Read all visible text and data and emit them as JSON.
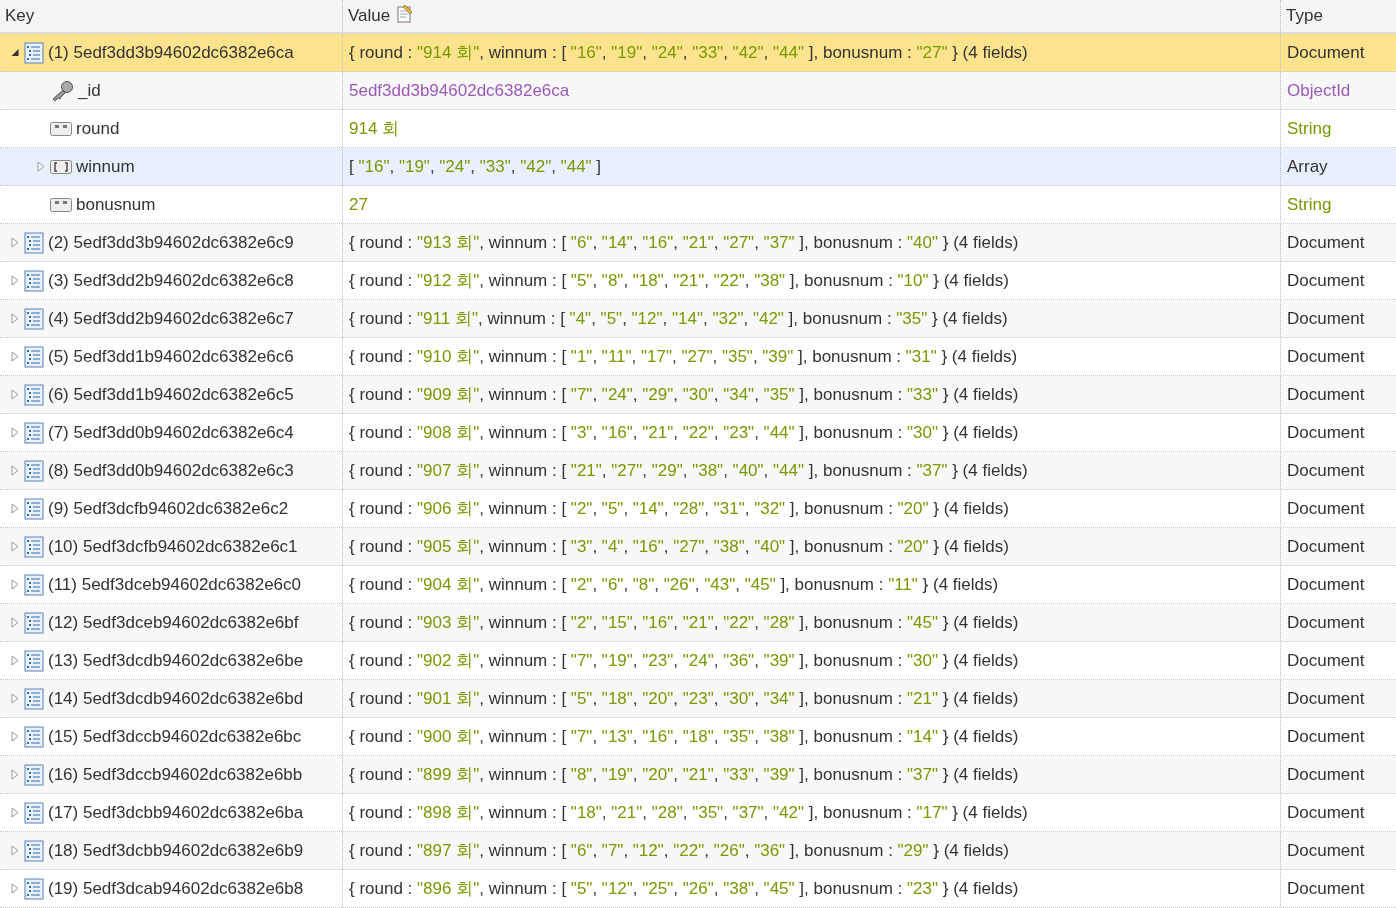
{
  "columns": [
    {
      "label": "Key",
      "edit_icon": false
    },
    {
      "label": "Value",
      "edit_icon": true
    },
    {
      "label": "Type",
      "edit_icon": false
    }
  ],
  "documents": [
    {
      "key": "(1) 5edf3dd3b94602dc6382e6ca",
      "expanded": true,
      "selected": true,
      "type": "Document",
      "value": [
        "{ round : ",
        "\"914 회\"",
        ", winnum : [ ",
        "\"16\"",
        ", ",
        "\"19\"",
        ", ",
        "\"24\"",
        ", ",
        "\"33\"",
        ", ",
        "\"42\"",
        ", ",
        "\"44\"",
        " ], bonusnum : ",
        "\"27\"",
        " } (4 fields)"
      ],
      "children": [
        {
          "kind": "objectid",
          "key": "_id",
          "value": [
            "5edf3dd3b94602dc6382e6ca"
          ],
          "type": "ObjectId",
          "hovered": false
        },
        {
          "kind": "string",
          "key": "round",
          "value": [
            "914 회"
          ],
          "type": "String",
          "hovered": false
        },
        {
          "kind": "array",
          "key": "winnum",
          "value": [
            "[ ",
            "\"16\"",
            ", ",
            "\"19\"",
            ", ",
            "\"24\"",
            ", ",
            "\"33\"",
            ", ",
            "\"42\"",
            ", ",
            "\"44\"",
            " ]"
          ],
          "type": "Array",
          "hovered": true
        },
        {
          "kind": "string",
          "key": "bonusnum",
          "value": [
            "27"
          ],
          "type": "String",
          "hovered": false
        }
      ]
    },
    {
      "key": "(2) 5edf3dd3b94602dc6382e6c9",
      "expanded": false,
      "selected": false,
      "type": "Document",
      "value": [
        "{ round : ",
        "\"913 회\"",
        ", winnum : [ ",
        "\"6\"",
        ", ",
        "\"14\"",
        ", ",
        "\"16\"",
        ", ",
        "\"21\"",
        ", ",
        "\"27\"",
        ", ",
        "\"37\"",
        " ], bonusnum : ",
        "\"40\"",
        " } (4 fields)"
      ]
    },
    {
      "key": "(3) 5edf3dd2b94602dc6382e6c8",
      "expanded": false,
      "selected": false,
      "type": "Document",
      "value": [
        "{ round : ",
        "\"912 회\"",
        ", winnum : [ ",
        "\"5\"",
        ", ",
        "\"8\"",
        ", ",
        "\"18\"",
        ", ",
        "\"21\"",
        ", ",
        "\"22\"",
        ", ",
        "\"38\"",
        " ], bonusnum : ",
        "\"10\"",
        " } (4 fields)"
      ]
    },
    {
      "key": "(4) 5edf3dd2b94602dc6382e6c7",
      "expanded": false,
      "selected": false,
      "type": "Document",
      "value": [
        "{ round : ",
        "\"911 회\"",
        ", winnum : [ ",
        "\"4\"",
        ", ",
        "\"5\"",
        ", ",
        "\"12\"",
        ", ",
        "\"14\"",
        ", ",
        "\"32\"",
        ", ",
        "\"42\"",
        " ], bonusnum : ",
        "\"35\"",
        " } (4 fields)"
      ]
    },
    {
      "key": "(5) 5edf3dd1b94602dc6382e6c6",
      "expanded": false,
      "selected": false,
      "type": "Document",
      "value": [
        "{ round : ",
        "\"910 회\"",
        ", winnum : [ ",
        "\"1\"",
        ", ",
        "\"11\"",
        ", ",
        "\"17\"",
        ", ",
        "\"27\"",
        ", ",
        "\"35\"",
        ", ",
        "\"39\"",
        " ], bonusnum : ",
        "\"31\"",
        " } (4 fields)"
      ]
    },
    {
      "key": "(6) 5edf3dd1b94602dc6382e6c5",
      "expanded": false,
      "selected": false,
      "type": "Document",
      "value": [
        "{ round : ",
        "\"909 회\"",
        ", winnum : [ ",
        "\"7\"",
        ", ",
        "\"24\"",
        ", ",
        "\"29\"",
        ", ",
        "\"30\"",
        ", ",
        "\"34\"",
        ", ",
        "\"35\"",
        " ], bonusnum : ",
        "\"33\"",
        " } (4 fields)"
      ]
    },
    {
      "key": "(7) 5edf3dd0b94602dc6382e6c4",
      "expanded": false,
      "selected": false,
      "type": "Document",
      "value": [
        "{ round : ",
        "\"908 회\"",
        ", winnum : [ ",
        "\"3\"",
        ", ",
        "\"16\"",
        ", ",
        "\"21\"",
        ", ",
        "\"22\"",
        ", ",
        "\"23\"",
        ", ",
        "\"44\"",
        " ], bonusnum : ",
        "\"30\"",
        " } (4 fields)"
      ]
    },
    {
      "key": "(8) 5edf3dd0b94602dc6382e6c3",
      "expanded": false,
      "selected": false,
      "type": "Document",
      "value": [
        "{ round : ",
        "\"907 회\"",
        ", winnum : [ ",
        "\"21\"",
        ", ",
        "\"27\"",
        ", ",
        "\"29\"",
        ", ",
        "\"38\"",
        ", ",
        "\"40\"",
        ", ",
        "\"44\"",
        " ], bonusnum : ",
        "\"37\"",
        " } (4 fields)"
      ]
    },
    {
      "key": "(9) 5edf3dcfb94602dc6382e6c2",
      "expanded": false,
      "selected": false,
      "type": "Document",
      "value": [
        "{ round : ",
        "\"906 회\"",
        ", winnum : [ ",
        "\"2\"",
        ", ",
        "\"5\"",
        ", ",
        "\"14\"",
        ", ",
        "\"28\"",
        ", ",
        "\"31\"",
        ", ",
        "\"32\"",
        " ], bonusnum : ",
        "\"20\"",
        " } (4 fields)"
      ]
    },
    {
      "key": "(10) 5edf3dcfb94602dc6382e6c1",
      "expanded": false,
      "selected": false,
      "type": "Document",
      "value": [
        "{ round : ",
        "\"905 회\"",
        ", winnum : [ ",
        "\"3\"",
        ", ",
        "\"4\"",
        ", ",
        "\"16\"",
        ", ",
        "\"27\"",
        ", ",
        "\"38\"",
        ", ",
        "\"40\"",
        " ], bonusnum : ",
        "\"20\"",
        " } (4 fields)"
      ]
    },
    {
      "key": "(11) 5edf3dceb94602dc6382e6c0",
      "expanded": false,
      "selected": false,
      "type": "Document",
      "value": [
        "{ round : ",
        "\"904 회\"",
        ", winnum : [ ",
        "\"2\"",
        ", ",
        "\"6\"",
        ", ",
        "\"8\"",
        ", ",
        "\"26\"",
        ", ",
        "\"43\"",
        ", ",
        "\"45\"",
        " ], bonusnum : ",
        "\"11\"",
        " } (4 fields)"
      ]
    },
    {
      "key": "(12) 5edf3dceb94602dc6382e6bf",
      "expanded": false,
      "selected": false,
      "type": "Document",
      "value": [
        "{ round : ",
        "\"903 회\"",
        ", winnum : [ ",
        "\"2\"",
        ", ",
        "\"15\"",
        ", ",
        "\"16\"",
        ", ",
        "\"21\"",
        ", ",
        "\"22\"",
        ", ",
        "\"28\"",
        " ], bonusnum : ",
        "\"45\"",
        " } (4 fields)"
      ]
    },
    {
      "key": "(13) 5edf3dcdb94602dc6382e6be",
      "expanded": false,
      "selected": false,
      "type": "Document",
      "value": [
        "{ round : ",
        "\"902 회\"",
        ", winnum : [ ",
        "\"7\"",
        ", ",
        "\"19\"",
        ", ",
        "\"23\"",
        ", ",
        "\"24\"",
        ", ",
        "\"36\"",
        ", ",
        "\"39\"",
        " ], bonusnum : ",
        "\"30\"",
        " } (4 fields)"
      ]
    },
    {
      "key": "(14) 5edf3dcdb94602dc6382e6bd",
      "expanded": false,
      "selected": false,
      "type": "Document",
      "value": [
        "{ round : ",
        "\"901 회\"",
        ", winnum : [ ",
        "\"5\"",
        ", ",
        "\"18\"",
        ", ",
        "\"20\"",
        ", ",
        "\"23\"",
        ", ",
        "\"30\"",
        ", ",
        "\"34\"",
        " ], bonusnum : ",
        "\"21\"",
        " } (4 fields)"
      ]
    },
    {
      "key": "(15) 5edf3dccb94602dc6382e6bc",
      "expanded": false,
      "selected": false,
      "type": "Document",
      "value": [
        "{ round : ",
        "\"900 회\"",
        ", winnum : [ ",
        "\"7\"",
        ", ",
        "\"13\"",
        ", ",
        "\"16\"",
        ", ",
        "\"18\"",
        ", ",
        "\"35\"",
        ", ",
        "\"38\"",
        " ], bonusnum : ",
        "\"14\"",
        " } (4 fields)"
      ]
    },
    {
      "key": "(16) 5edf3dccb94602dc6382e6bb",
      "expanded": false,
      "selected": false,
      "type": "Document",
      "value": [
        "{ round : ",
        "\"899 회\"",
        ", winnum : [ ",
        "\"8\"",
        ", ",
        "\"19\"",
        ", ",
        "\"20\"",
        ", ",
        "\"21\"",
        ", ",
        "\"33\"",
        ", ",
        "\"39\"",
        " ], bonusnum : ",
        "\"37\"",
        " } (4 fields)"
      ]
    },
    {
      "key": "(17) 5edf3dcbb94602dc6382e6ba",
      "expanded": false,
      "selected": false,
      "type": "Document",
      "value": [
        "{ round : ",
        "\"898 회\"",
        ", winnum : [ ",
        "\"18\"",
        ", ",
        "\"21\"",
        ", ",
        "\"28\"",
        ", ",
        "\"35\"",
        ", ",
        "\"37\"",
        ", ",
        "\"42\"",
        " ], bonusnum : ",
        "\"17\"",
        " } (4 fields)"
      ]
    },
    {
      "key": "(18) 5edf3dcbb94602dc6382e6b9",
      "expanded": false,
      "selected": false,
      "type": "Document",
      "value": [
        "{ round : ",
        "\"897 회\"",
        ", winnum : [ ",
        "\"6\"",
        ", ",
        "\"7\"",
        ", ",
        "\"12\"",
        ", ",
        "\"22\"",
        ", ",
        "\"26\"",
        ", ",
        "\"36\"",
        " ], bonusnum : ",
        "\"29\"",
        " } (4 fields)"
      ]
    },
    {
      "key": "(19) 5edf3dcab94602dc6382e6b8",
      "expanded": false,
      "selected": false,
      "type": "Document",
      "value": [
        "{ round : ",
        "\"896 회\"",
        ", winnum : [ ",
        "\"5\"",
        ", ",
        "\"12\"",
        ", ",
        "\"25\"",
        ", ",
        "\"26\"",
        ", ",
        "\"38\"",
        ", ",
        "\"45\"",
        " ], bonusnum : ",
        "\"23\"",
        " } (4 fields)"
      ]
    }
  ]
}
